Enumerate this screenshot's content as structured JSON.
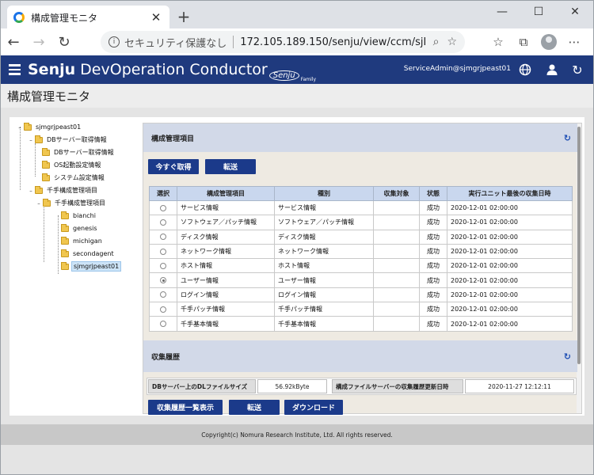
{
  "browser": {
    "tab_title": "構成管理モニタ",
    "security_label": "セキュリティ保護なし",
    "url": "172.105.189.150/senju/view/ccm/sjI..."
  },
  "header": {
    "brand_bold": "Senju",
    "brand_rest": " DevOperation Conductor",
    "brand_logo": "Senju",
    "brand_sub": "Family",
    "user": "ServiceAdmin@sjmgrjpeast01"
  },
  "page": {
    "title": "構成管理モニタ"
  },
  "tree": {
    "root": "sjmgrjpeast01",
    "db_group": "DBサーバー取得情報",
    "db_items": [
      "DBサーバー取得情報",
      "OS起動設定情報",
      "システム設定情報"
    ],
    "manual_group": "千手構成管理項目",
    "manual_sub": "千手構成管理項目",
    "hosts": [
      "bianchi",
      "genesis",
      "michigan",
      "secondagent",
      "sjmgrjpeast01"
    ]
  },
  "config_section": {
    "title": "構成管理項目",
    "btn_collect_now": "今すぐ取得",
    "btn_transfer": "転送",
    "columns": [
      "選択",
      "構成管理項目",
      "種別",
      "収集対象",
      "状態",
      "実行ユニット最後の収集日時"
    ],
    "rows": [
      {
        "item": "サービス情報",
        "type": "サービス情報",
        "target": "",
        "status": "成功",
        "date": "2020-12-01 02:00:00",
        "selected": false
      },
      {
        "item": "ソフトウェア／パッチ情報",
        "type": "ソフトウェア／パッチ情報",
        "target": "",
        "status": "成功",
        "date": "2020-12-01 02:00:00",
        "selected": false
      },
      {
        "item": "ディスク情報",
        "type": "ディスク情報",
        "target": "",
        "status": "成功",
        "date": "2020-12-01 02:00:00",
        "selected": false
      },
      {
        "item": "ネットワーク情報",
        "type": "ネットワーク情報",
        "target": "",
        "status": "成功",
        "date": "2020-12-01 02:00:00",
        "selected": false
      },
      {
        "item": "ホスト情報",
        "type": "ホスト情報",
        "target": "",
        "status": "成功",
        "date": "2020-12-01 02:00:00",
        "selected": false
      },
      {
        "item": "ユーザー情報",
        "type": "ユーザー情報",
        "target": "",
        "status": "成功",
        "date": "2020-12-01 02:00:00",
        "selected": true
      },
      {
        "item": "ログイン情報",
        "type": "ログイン情報",
        "target": "",
        "status": "成功",
        "date": "2020-12-01 02:00:00",
        "selected": false
      },
      {
        "item": "千手パッチ情報",
        "type": "千手パッチ情報",
        "target": "",
        "status": "成功",
        "date": "2020-12-01 02:00:00",
        "selected": false
      },
      {
        "item": "千手基本情報",
        "type": "千手基本情報",
        "target": "",
        "status": "成功",
        "date": "2020-12-01 02:00:00",
        "selected": false
      }
    ]
  },
  "history_section": {
    "title": "収集履歴",
    "dl_size_label": "DBサーバー上のDLファイルサイズ",
    "dl_size_value": "56.92kByte",
    "update_label": "構成ファイルサーバーの収集履歴更新日時",
    "update_value": "2020-11-27 12:12:11",
    "btn_list": "収集履歴一覧表示",
    "btn_transfer": "転送",
    "btn_download": "ダウンロード"
  },
  "footer": {
    "copyright": "Copyright(c) Nomura Research Institute, Ltd. All rights reserved."
  },
  "colors": {
    "header_bg": "#1f3a7e",
    "button_bg": "#1b3a8a",
    "table_header_bg": "#c9d7ee",
    "section_head_bg": "#d2d9e8"
  }
}
